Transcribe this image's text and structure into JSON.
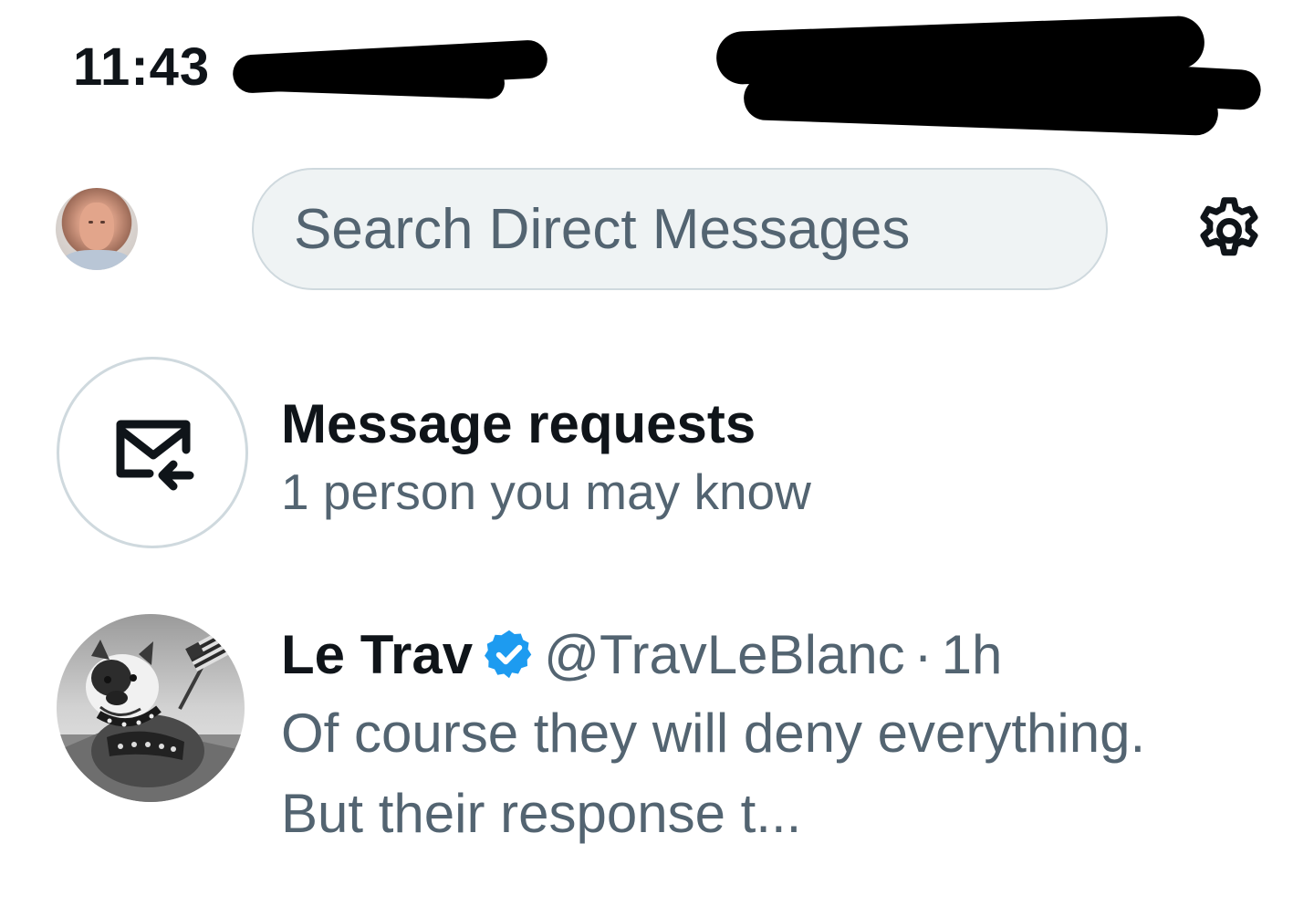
{
  "status_bar": {
    "time": "11:43"
  },
  "header": {
    "search_placeholder": "Search Direct Messages",
    "avatar_icon": "profile-avatar",
    "settings_icon": "gear-icon"
  },
  "message_requests": {
    "title": "Message requests",
    "subtitle": "1 person you may know",
    "icon": "envelope-incoming-icon"
  },
  "conversations": [
    {
      "name": "Le Trav",
      "verified": true,
      "handle": "@TravLeBlanc",
      "separator": "·",
      "time": "1h",
      "preview": "Of course they will deny everything. But their response t..."
    }
  ],
  "colors": {
    "text_primary": "#0f1419",
    "text_secondary": "#536471",
    "search_bg": "#eff3f4",
    "border": "#cfd9de",
    "verified_blue": "#1d9bf0"
  }
}
